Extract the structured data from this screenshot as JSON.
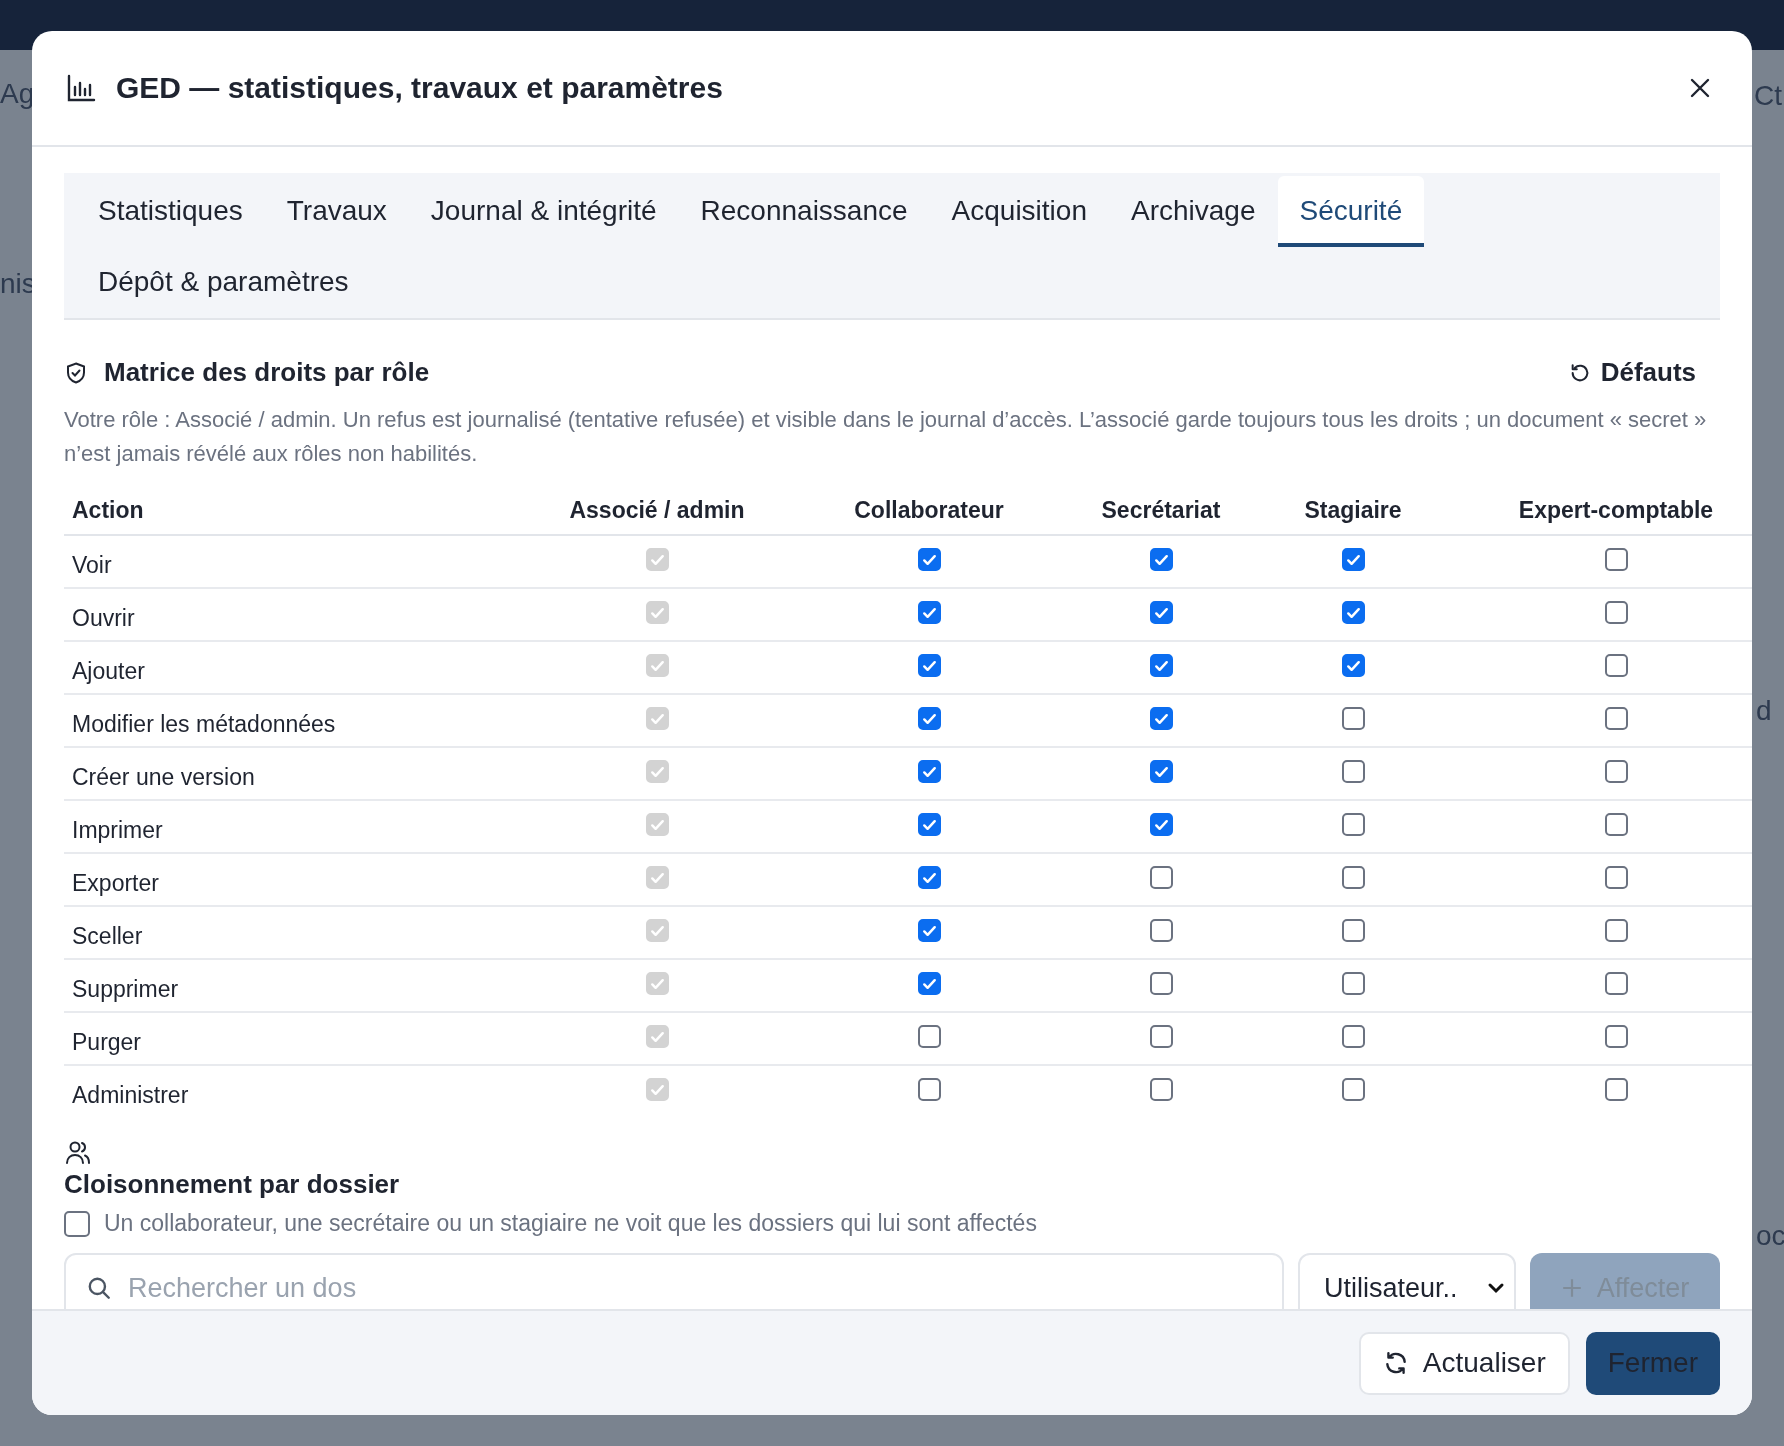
{
  "background": {
    "fragments": [
      "Ag",
      "nis",
      "Ct",
      "d",
      "oc"
    ]
  },
  "dialog": {
    "title": "GED — statistiques, travaux et paramètres"
  },
  "tabs": [
    {
      "label": "Statistiques",
      "selected": false
    },
    {
      "label": "Travaux",
      "selected": false
    },
    {
      "label": "Journal & intégrité",
      "selected": false
    },
    {
      "label": "Reconnaissance",
      "selected": false
    },
    {
      "label": "Acquisition",
      "selected": false
    },
    {
      "label": "Archivage",
      "selected": false
    },
    {
      "label": "Sécurité",
      "selected": true
    },
    {
      "label": "Dépôt & paramètres",
      "selected": false
    }
  ],
  "matrix": {
    "title": "Matrice des droits par rôle",
    "reset_button": "Défauts",
    "description": "Votre rôle : Associé / admin. Un refus est journalisé (tentative refusée) et visible dans le journal d’accès. L’associé garde toujours tous les droits ; un document « secret » n’est jamais révélé aux rôles non habilités.",
    "columns": [
      "Action",
      "Associé / admin",
      "Collaborateur",
      "Secrétariat",
      "Stagiaire",
      "Expert-comptable"
    ],
    "rows": [
      {
        "action": "Voir",
        "cells": [
          {
            "checked": true,
            "disabled": true
          },
          {
            "checked": true,
            "disabled": false
          },
          {
            "checked": true,
            "disabled": false
          },
          {
            "checked": true,
            "disabled": false
          },
          {
            "checked": false,
            "disabled": false
          }
        ]
      },
      {
        "action": "Ouvrir",
        "cells": [
          {
            "checked": true,
            "disabled": true
          },
          {
            "checked": true,
            "disabled": false
          },
          {
            "checked": true,
            "disabled": false
          },
          {
            "checked": true,
            "disabled": false
          },
          {
            "checked": false,
            "disabled": false
          }
        ]
      },
      {
        "action": "Ajouter",
        "cells": [
          {
            "checked": true,
            "disabled": true
          },
          {
            "checked": true,
            "disabled": false
          },
          {
            "checked": true,
            "disabled": false
          },
          {
            "checked": true,
            "disabled": false
          },
          {
            "checked": false,
            "disabled": false
          }
        ]
      },
      {
        "action": "Modifier les métadonnées",
        "cells": [
          {
            "checked": true,
            "disabled": true
          },
          {
            "checked": true,
            "disabled": false
          },
          {
            "checked": true,
            "disabled": false
          },
          {
            "checked": false,
            "disabled": false
          },
          {
            "checked": false,
            "disabled": false
          }
        ]
      },
      {
        "action": "Créer une version",
        "cells": [
          {
            "checked": true,
            "disabled": true
          },
          {
            "checked": true,
            "disabled": false
          },
          {
            "checked": true,
            "disabled": false
          },
          {
            "checked": false,
            "disabled": false
          },
          {
            "checked": false,
            "disabled": false
          }
        ]
      },
      {
        "action": "Imprimer",
        "cells": [
          {
            "checked": true,
            "disabled": true
          },
          {
            "checked": true,
            "disabled": false
          },
          {
            "checked": true,
            "disabled": false
          },
          {
            "checked": false,
            "disabled": false
          },
          {
            "checked": false,
            "disabled": false
          }
        ]
      },
      {
        "action": "Exporter",
        "cells": [
          {
            "checked": true,
            "disabled": true
          },
          {
            "checked": true,
            "disabled": false
          },
          {
            "checked": false,
            "disabled": false
          },
          {
            "checked": false,
            "disabled": false
          },
          {
            "checked": false,
            "disabled": false
          }
        ]
      },
      {
        "action": "Sceller",
        "cells": [
          {
            "checked": true,
            "disabled": true
          },
          {
            "checked": true,
            "disabled": false
          },
          {
            "checked": false,
            "disabled": false
          },
          {
            "checked": false,
            "disabled": false
          },
          {
            "checked": false,
            "disabled": false
          }
        ]
      },
      {
        "action": "Supprimer",
        "cells": [
          {
            "checked": true,
            "disabled": true
          },
          {
            "checked": true,
            "disabled": false
          },
          {
            "checked": false,
            "disabled": false
          },
          {
            "checked": false,
            "disabled": false
          },
          {
            "checked": false,
            "disabled": false
          }
        ]
      },
      {
        "action": "Purger",
        "cells": [
          {
            "checked": true,
            "disabled": true
          },
          {
            "checked": false,
            "disabled": false
          },
          {
            "checked": false,
            "disabled": false
          },
          {
            "checked": false,
            "disabled": false
          },
          {
            "checked": false,
            "disabled": false
          }
        ]
      },
      {
        "action": "Administrer",
        "cells": [
          {
            "checked": true,
            "disabled": true
          },
          {
            "checked": false,
            "disabled": false
          },
          {
            "checked": false,
            "disabled": false
          },
          {
            "checked": false,
            "disabled": false
          },
          {
            "checked": false,
            "disabled": false
          }
        ]
      }
    ]
  },
  "partitioning": {
    "title": "Cloisonnement par dossier",
    "option": {
      "label": "Un collaborateur, une secrétaire ou un stagiaire ne voit que les dossiers qui lui sont affectés",
      "checked": false
    },
    "search": {
      "placeholder": "Rechercher un dos"
    },
    "user_select": {
      "value": "Utilisateur.."
    },
    "assign_button": {
      "label": "Affecter",
      "disabled": true
    }
  },
  "footer": {
    "buttons": [
      {
        "label": "Actualiser",
        "kind": "secondary"
      },
      {
        "label": "Fermer",
        "kind": "primary"
      }
    ]
  }
}
